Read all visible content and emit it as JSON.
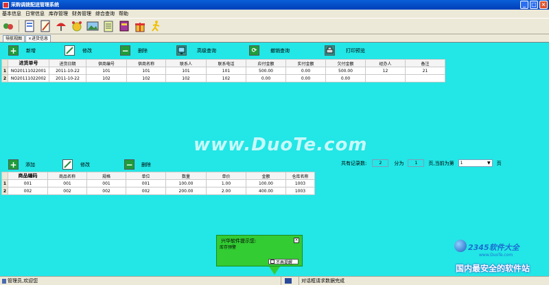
{
  "window": {
    "title": "采购调拨配送管理系统"
  },
  "menu": [
    "基本信息",
    "日常信息",
    "库存管理",
    "财务管理",
    "综合查询",
    "帮助"
  ],
  "toolbar": {
    "icons": [
      "users-icon",
      "document-icon",
      "edit-doc-icon",
      "umbrella-icon",
      "alarm-clock-icon",
      "picture-icon",
      "notepad-icon",
      "book-icon",
      "gift-icon",
      "running-man-icon"
    ]
  },
  "tabs": [
    "导航视图",
    "×进货信息"
  ],
  "top_actions": {
    "add": "新增",
    "edit": "修改",
    "delete": "删除",
    "advanced": "高级查询",
    "cancel_query": "撤销查询",
    "print": "打印预览"
  },
  "top_table": {
    "headers": [
      "进货单号",
      "进货日期",
      "供商编号",
      "供商名称",
      "联系人",
      "联系电话",
      "应付金额",
      "实付金额",
      "欠付金额",
      "经办人",
      "备注"
    ],
    "rows": [
      {
        "num": "1",
        "cells": [
          "NO20111022001",
          "2011-10-22",
          "101",
          "101",
          "101",
          "101",
          "500.00",
          "0.00",
          "500.00",
          "12",
          "21"
        ]
      },
      {
        "num": "2",
        "cells": [
          "NO20111022002",
          "2011-10-22",
          "102",
          "102",
          "102",
          "102",
          "0.00",
          "0.00",
          "0.00",
          "",
          ""
        ]
      }
    ]
  },
  "bottom_actions": {
    "add": "添加",
    "edit": "修改",
    "delete": "删除"
  },
  "pager": {
    "total_label": "共有记录数:",
    "total": "2",
    "split_label": "分为",
    "pages": "1",
    "current_label": "页,当前为第",
    "current": "1",
    "page_suffix": "页"
  },
  "bottom_table": {
    "headers": [
      "商品编码",
      "商品名称",
      "规格",
      "单位",
      "数量",
      "单价",
      "金额",
      "仓库名称"
    ],
    "rows": [
      {
        "num": "1",
        "cells": [
          "001",
          "001",
          "001",
          "001",
          "100.00",
          "1.00",
          "100.00",
          "1003"
        ]
      },
      {
        "num": "2",
        "cells": [
          "002",
          "002",
          "002",
          "002",
          "200.00",
          "2.00",
          "400.00",
          "1003"
        ]
      }
    ]
  },
  "popup": {
    "title": "兴华软件提示您:",
    "message": "库存预警",
    "checkbox": "不再提醒",
    "close": "×"
  },
  "watermark": "www.DuoTe.com",
  "logo": {
    "brand": "2345软件大全",
    "url": "www.DuoTe.com",
    "slogan": "国内最安全的软件站"
  },
  "statusbar": {
    "user": "管理员,欢迎您",
    "message": "对话框请求数据完成"
  },
  "colors": {
    "panel": "#23e6e6",
    "popup": "#33cc33",
    "titlebar": "#0a5fd8"
  }
}
